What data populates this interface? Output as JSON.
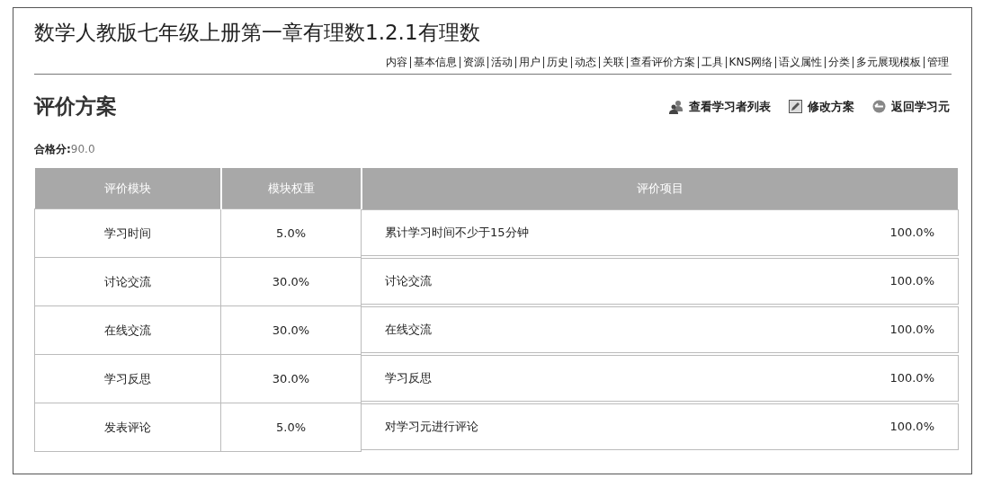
{
  "page_title": "数学人教版七年级上册第一章有理数1.2.1有理数",
  "nav": [
    {
      "label": "内容"
    },
    {
      "label": "基本信息"
    },
    {
      "label": "资源"
    },
    {
      "label": "活动"
    },
    {
      "label": "用户"
    },
    {
      "label": "历史"
    },
    {
      "label": "动态"
    },
    {
      "label": "关联"
    },
    {
      "label": "查看评价方案"
    },
    {
      "label": "工具"
    },
    {
      "label": "KNS网络"
    },
    {
      "label": "语义属性"
    },
    {
      "label": "分类"
    },
    {
      "label": "多元展现模板"
    },
    {
      "label": "管理"
    }
  ],
  "section_title": "评价方案",
  "actions": [
    {
      "kind": "users",
      "label": "查看学习者列表"
    },
    {
      "kind": "edit",
      "label": "修改方案"
    },
    {
      "kind": "back",
      "label": "返回学习元"
    }
  ],
  "pass_score": {
    "label": "合格分:",
    "value": "90.0"
  },
  "table": {
    "columns": [
      "评价模块",
      "模块权重",
      "评价项目"
    ],
    "rows": [
      {
        "module": "学习时间",
        "weight": "5.0%",
        "item": "累计学习时间不少于15分钟",
        "item_score": "100.0%"
      },
      {
        "module": "讨论交流",
        "weight": "30.0%",
        "item": "讨论交流",
        "item_score": "100.0%"
      },
      {
        "module": "在线交流",
        "weight": "30.0%",
        "item": "在线交流",
        "item_score": "100.0%"
      },
      {
        "module": "学习反思",
        "weight": "30.0%",
        "item": "学习反思",
        "item_score": "100.0%"
      },
      {
        "module": "发表评论",
        "weight": "5.0%",
        "item": "对学习元进行评论",
        "item_score": "100.0%"
      }
    ]
  }
}
